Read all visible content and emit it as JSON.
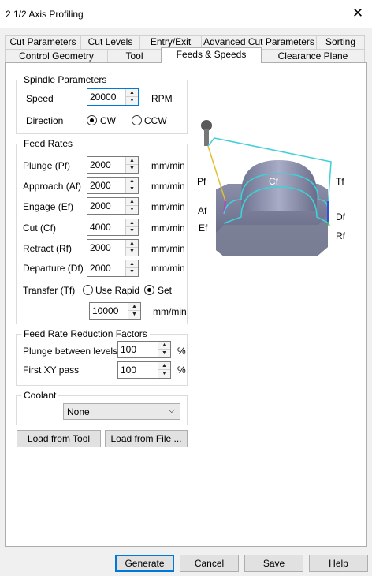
{
  "window": {
    "title": "2 1/2 Axis Profiling",
    "close_glyph": "✕"
  },
  "tabs_back": [
    "Cut Parameters",
    "Cut Levels",
    "Entry/Exit",
    "Advanced Cut Parameters",
    "Sorting"
  ],
  "tabs_front": [
    "Control Geometry",
    "Tool",
    "Feeds & Speeds",
    "Clearance Plane"
  ],
  "active_tab": "Feeds & Speeds",
  "spindle": {
    "legend": "Spindle Parameters",
    "speed_label": "Speed",
    "speed_value": "20000",
    "speed_unit": "RPM",
    "direction_label": "Direction",
    "cw_label": "CW",
    "ccw_label": "CCW",
    "direction_selected": "CW"
  },
  "feed_rates": {
    "legend": "Feed Rates",
    "rows": [
      {
        "label": "Plunge (Pf)",
        "value": "2000",
        "unit": "mm/min"
      },
      {
        "label": "Approach (Af)",
        "value": "2000",
        "unit": "mm/min"
      },
      {
        "label": "Engage (Ef)",
        "value": "2000",
        "unit": "mm/min"
      },
      {
        "label": "Cut (Cf)",
        "value": "4000",
        "unit": "mm/min"
      },
      {
        "label": "Retract (Rf)",
        "value": "2000",
        "unit": "mm/min"
      },
      {
        "label": "Departure  (Df)",
        "value": "2000",
        "unit": "mm/min"
      }
    ],
    "transfer_label": "Transfer (Tf)",
    "use_rapid_label": "Use Rapid",
    "set_label": "Set",
    "transfer_selected": "Set",
    "transfer_value": "10000",
    "transfer_unit": "mm/min"
  },
  "reduction": {
    "legend": "Feed Rate Reduction Factors",
    "plunge_label": "Plunge between levels",
    "plunge_value": "100",
    "plunge_unit": "%",
    "xy_label": "First XY pass",
    "xy_value": "100",
    "xy_unit": "%"
  },
  "coolant": {
    "legend": "Coolant",
    "selected": "None"
  },
  "load_buttons": {
    "from_tool": "Load from Tool",
    "from_file": "Load from File ..."
  },
  "diagram_labels": {
    "pf": "Pf",
    "cf": "Cf",
    "tf": "Tf",
    "af": "Af",
    "ef": "Ef",
    "df": "Df",
    "rf": "Rf"
  },
  "footer": {
    "generate": "Generate",
    "cancel": "Cancel",
    "save": "Save",
    "help": "Help"
  }
}
